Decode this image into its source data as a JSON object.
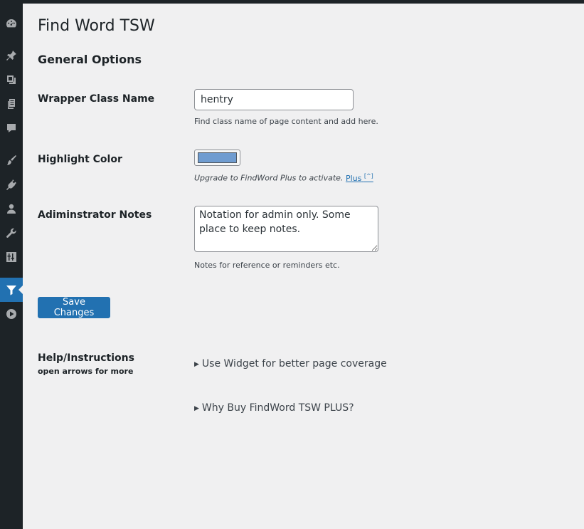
{
  "page": {
    "title": "Find Word TSW",
    "section_title": "General Options"
  },
  "sidebar": {
    "items": [
      {
        "icon": "dashboard-icon"
      },
      {
        "icon": "pin-icon"
      },
      {
        "icon": "media-icon"
      },
      {
        "icon": "pages-icon"
      },
      {
        "icon": "comments-icon"
      },
      {
        "icon": "appearance-icon"
      },
      {
        "icon": "plugins-icon"
      },
      {
        "icon": "users-icon"
      },
      {
        "icon": "tools-icon"
      },
      {
        "icon": "settings-icon"
      },
      {
        "icon": "filter-icon",
        "active": true
      },
      {
        "icon": "play-icon"
      }
    ],
    "active_color": "#2271b1"
  },
  "fields": {
    "wrapper": {
      "label": "Wrapper Class Name",
      "value": "hentry",
      "description": "Find class name of page content and add here."
    },
    "highlight": {
      "label": "Highlight Color",
      "color": "#6f9cd0",
      "description": "Upgrade to FindWord Plus to activate.",
      "link_text": "Plus",
      "link_sup": "[^]"
    },
    "notes": {
      "label": "Adiminstrator Notes",
      "value": "Notation for admin only. Some place to keep notes.",
      "description": "Notes for reference or reminders etc."
    }
  },
  "save_button": "Save Changes",
  "help": {
    "title": "Help/Instructions",
    "subtitle": "open arrows for more",
    "items": [
      {
        "summary": "Use Widget for better page coverage"
      },
      {
        "summary": "Why Buy FindWord TSW PLUS?"
      }
    ]
  }
}
